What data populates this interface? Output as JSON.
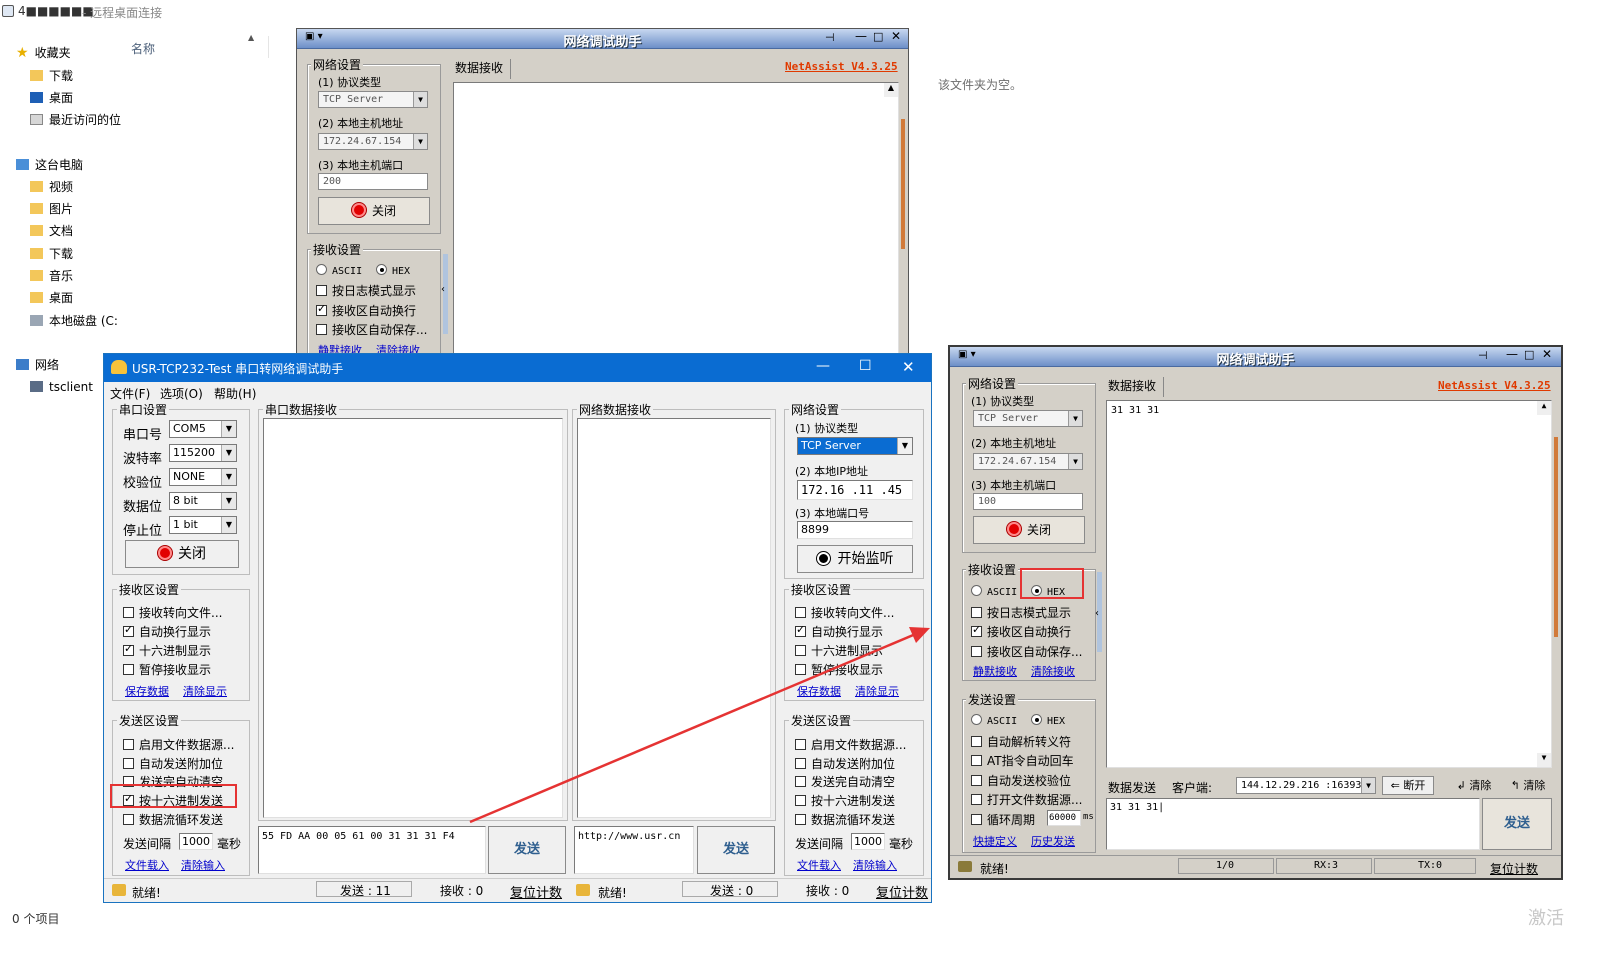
{
  "rdp": {
    "title_hidden": "4■■■■■■",
    "title": " - 远程桌面连接"
  },
  "explorer": {
    "favorites_label": "收藏夹",
    "favorites": [
      "下载",
      "桌面",
      "最近访问的位"
    ],
    "this_pc_label": "这台电脑",
    "pc_items": [
      "视频",
      "图片",
      "文档",
      "下载",
      "音乐",
      "桌面",
      "本地磁盘 (C:"
    ],
    "network_label": "网络",
    "network_items": [
      "tsclient"
    ],
    "column_name": "名称",
    "empty_text": "该文件夹为空。",
    "status": "0 个项目"
  },
  "netassist1": {
    "title": "网络调试助手",
    "version": "NetAssist V4.3.25",
    "tab": "数据接收",
    "net_settings": "网络设置",
    "proto_label": "(1) 协议类型",
    "proto_value": "TCP Server",
    "host_label": "(2) 本地主机地址",
    "host_value": "172.24.67.154",
    "port_label": "(3) 本地主机端口",
    "port_value": "200",
    "close_btn": "关闭",
    "recv_settings": "接收设置",
    "ascii": "ASCII",
    "hex": "HEX",
    "log_mode": "按日志模式显示",
    "auto_wrap": "接收区自动换行",
    "auto_save": "接收区自动保存...",
    "silent_recv": "静默接收",
    "clear_recv": "清除接收"
  },
  "usr": {
    "title": "USR-TCP232-Test 串口转网络调试助手",
    "menu": [
      "文件(F)",
      "选项(O)",
      "帮助(H)"
    ],
    "serial_settings": "串口设置",
    "port_label": "串口号",
    "port_value": "COM5",
    "baud_label": "波特率",
    "baud_value": "115200",
    "parity_label": "校验位",
    "parity_value": "NONE",
    "databits_label": "数据位",
    "databits_value": "8 bit",
    "stopbits_label": "停止位",
    "stopbits_value": "1 bit",
    "close_btn": "关闭",
    "serial_recv_title": "串口数据接收",
    "net_recv_title": "网络数据接收",
    "recv_area_settings": "接收区设置",
    "recv_to_file": "接收转向文件...",
    "auto_wrap_display": "自动换行显示",
    "hex_display": "十六进制显示",
    "pause_display": "暂停接收显示",
    "save_data": "保存数据",
    "clear_display": "清除显示",
    "send_area_settings": "发送区设置",
    "file_source": "启用文件数据源...",
    "auto_append": "自动发送附加位",
    "auto_clear": "发送完自动清空",
    "hex_send": "按十六进制发送",
    "loop_send": "数据流循环发送",
    "interval_label": "发送间隔",
    "interval_value": "1000",
    "interval_unit": "毫秒",
    "file_load": "文件载入",
    "clear_input": "清除输入",
    "serial_send_text": "55 FD AA 00 05 61 00 31 31 31 F4",
    "send_btn": "发送",
    "net_send_text": "http://www.usr.cn",
    "net_settings": "网络设置",
    "proto_label": "(1) 协议类型",
    "proto_value": "TCP Server",
    "ip_label": "(2) 本地IP地址",
    "ip_value": "172.16 .11 .45",
    "port_num_label": "(3) 本地端口号",
    "port_num_value": "8899",
    "start_listen": "开始监听",
    "ready": "就绪!",
    "sent_left": "发送 : 11",
    "recv_left": "接收 : 0",
    "reset_count": "复位计数",
    "sent_right": "发送 : 0",
    "recv_right": "接收 : 0"
  },
  "netassist2": {
    "title": "网络调试助手",
    "version": "NetAssist V4.3.25",
    "tab": "数据接收",
    "recv_text": "31 31 31",
    "net_settings": "网络设置",
    "proto_label": "(1) 协议类型",
    "proto_value": "TCP Server",
    "host_label": "(2) 本地主机地址",
    "host_value": "172.24.67.154",
    "port_label": "(3) 本地主机端口",
    "port_value": "100",
    "close_btn": "关闭",
    "recv_settings": "接收设置",
    "ascii": "ASCII",
    "hex": "HEX",
    "log_mode": "按日志模式显示",
    "auto_wrap": "接收区自动换行",
    "auto_save": "接收区自动保存...",
    "silent_recv": "静默接收",
    "clear_recv": "清除接收",
    "send_settings": "发送设置",
    "parse_escape": "自动解析转义符",
    "at_cr": "AT指令自动回车",
    "auto_checksum": "自动发送校验位",
    "file_source": "打开文件数据源...",
    "loop_period": "循环周期",
    "loop_value": "60000",
    "loop_unit": "ms",
    "quick_def": "快捷定义",
    "history_send": "历史发送",
    "data_send_label": "数据发送",
    "client_label": "客户端:",
    "client_value": "144.12.29.216 :16393",
    "disconnect": "断开",
    "clear1": "清除",
    "clear2": "清除",
    "send_text": "31 31 31",
    "send_btn": "发送",
    "ready": "就绪!",
    "page": "1/0",
    "rx": "RX:3",
    "tx": "TX:0",
    "reset_count": "复位计数"
  },
  "watermark": "激活"
}
